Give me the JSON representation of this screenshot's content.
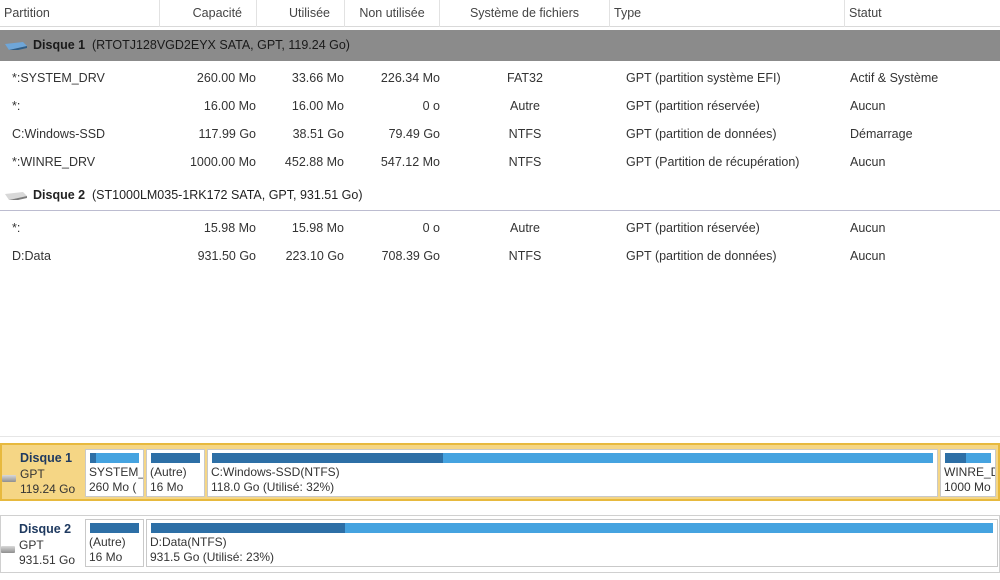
{
  "columns": {
    "partition": "Partition",
    "capacity": "Capacité",
    "used": "Utilisée",
    "unused": "Non utilisée",
    "filesystem": "Système de fichiers",
    "type": "Type",
    "status": "Statut"
  },
  "disks": [
    {
      "name": "Disque 1",
      "info": "(RTOTJ128VGD2EYX SATA, GPT, 119.24 Go)",
      "partitions": [
        {
          "partition": "*:SYSTEM_DRV",
          "capacity": "260.00 Mo",
          "used": "33.66 Mo",
          "unused": "226.34 Mo",
          "fs": "FAT32",
          "type": "GPT (partition système EFI)",
          "status": "Actif & Système"
        },
        {
          "partition": "*:",
          "capacity": "16.00 Mo",
          "used": "16.00 Mo",
          "unused": "0 o",
          "fs": "Autre",
          "type": "GPT (partition réservée)",
          "status": "Aucun"
        },
        {
          "partition": "C:Windows-SSD",
          "capacity": "117.99 Go",
          "used": "38.51 Go",
          "unused": "79.49 Go",
          "fs": "NTFS",
          "type": "GPT (partition de données)",
          "status": "Démarrage"
        },
        {
          "partition": "*:WINRE_DRV",
          "capacity": "1000.00 Mo",
          "used": "452.88 Mo",
          "unused": "547.12 Mo",
          "fs": "NTFS",
          "type": "GPT (Partition de récupération)",
          "status": "Aucun"
        }
      ]
    },
    {
      "name": "Disque 2",
      "info": "(ST1000LM035-1RK172 SATA, GPT, 931.51 Go)",
      "partitions": [
        {
          "partition": "*:",
          "capacity": "15.98 Mo",
          "used": "15.98 Mo",
          "unused": "0 o",
          "fs": "Autre",
          "type": "GPT (partition réservée)",
          "status": "Aucun"
        },
        {
          "partition": "D:Data",
          "capacity": "931.50 Go",
          "used": "223.10 Go",
          "unused": "708.39 Go",
          "fs": "NTFS",
          "type": "GPT (partition de données)",
          "status": "Aucun"
        }
      ]
    }
  ],
  "diskmap": [
    {
      "name": "Disque 1",
      "scheme": "GPT",
      "size": "119.24 Go",
      "selected": true,
      "blocks": [
        {
          "line1": "SYSTEM_",
          "line2": "260 Mo (",
          "fill": 0.13
        },
        {
          "line1": "(Autre)",
          "line2": "16 Mo",
          "fill": 1.0
        },
        {
          "line1": "C:Windows-SSD(NTFS)",
          "line2": "118.0 Go (Utilisé: 32%)",
          "fill": 0.32
        },
        {
          "line1": "WINRE_D",
          "line2": "1000 Mo",
          "fill": 0.45
        }
      ]
    },
    {
      "name": "Disque 2",
      "scheme": "GPT",
      "size": "931.51 Go",
      "selected": false,
      "blocks": [
        {
          "line1": "(Autre)",
          "line2": "16 Mo",
          "fill": 1.0
        },
        {
          "line1": "D:Data(NTFS)",
          "line2": "931.5 Go (Utilisé: 23%)",
          "fill": 0.23
        }
      ]
    }
  ],
  "colors": {
    "selection_row": "#8b8b8b",
    "map_highlight": "#f5d685",
    "usage_bar": "#45a3e0",
    "usage_fill": "#2d6fa6"
  }
}
